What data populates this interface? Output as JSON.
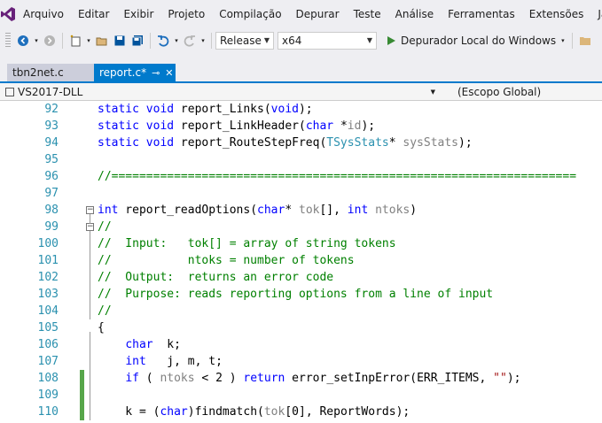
{
  "menu": {
    "items": [
      "Arquivo",
      "Editar",
      "Exibir",
      "Projeto",
      "Compilação",
      "Depurar",
      "Teste",
      "Análise",
      "Ferramentas",
      "Extensões",
      "Ja"
    ]
  },
  "toolbar": {
    "config": "Release",
    "platform": "x64",
    "debugger": "Depurador Local do Windows"
  },
  "tabs": [
    {
      "label": "tbn2net.c",
      "active": false
    },
    {
      "label": "report.c*",
      "active": true
    }
  ],
  "navbar": {
    "project": "VS2017-DLL",
    "scope": "(Escopo Global)"
  },
  "colors": {
    "accent": "#007acc",
    "keyword": "#0000ff",
    "comment": "#008000",
    "type": "#2b91af",
    "string": "#a31515",
    "changed": "#57a64a"
  },
  "code": {
    "lines": [
      {
        "n": "92",
        "tokens": [
          {
            "t": "static void",
            "c": "kw"
          },
          {
            "t": " report_Links("
          },
          {
            "t": "void",
            "c": "kw"
          },
          {
            "t": ");"
          }
        ]
      },
      {
        "n": "93",
        "tokens": [
          {
            "t": "static void",
            "c": "kw"
          },
          {
            "t": " report_LinkHeader("
          },
          {
            "t": "char",
            "c": "kw"
          },
          {
            "t": " *"
          },
          {
            "t": "id",
            "c": "pm"
          },
          {
            "t": ");"
          }
        ]
      },
      {
        "n": "94",
        "tokens": [
          {
            "t": "static void",
            "c": "kw"
          },
          {
            "t": " report_RouteStepFreq("
          },
          {
            "t": "TSysStats",
            "c": "ty"
          },
          {
            "t": "* "
          },
          {
            "t": "sysStats",
            "c": "pm"
          },
          {
            "t": ");"
          }
        ]
      },
      {
        "n": "95",
        "tokens": []
      },
      {
        "n": "96",
        "tokens": [
          {
            "t": "//===================================================================",
            "c": "cm"
          }
        ]
      },
      {
        "n": "97",
        "tokens": []
      },
      {
        "n": "98",
        "fold": true,
        "indent": 0,
        "tokens": [
          {
            "t": "int",
            "c": "kw"
          },
          {
            "t": " report_readOptions("
          },
          {
            "t": "char",
            "c": "kw"
          },
          {
            "t": "* "
          },
          {
            "t": "tok",
            "c": "pm"
          },
          {
            "t": "[], "
          },
          {
            "t": "int",
            "c": "kw"
          },
          {
            "t": " "
          },
          {
            "t": "ntoks",
            "c": "pm"
          },
          {
            "t": ")"
          }
        ]
      },
      {
        "n": "99",
        "fold": true,
        "indent": 0,
        "tokens": [
          {
            "t": "//",
            "c": "cm"
          }
        ]
      },
      {
        "n": "100",
        "tokens": [
          {
            "t": "//  Input:   tok[] = array of string tokens",
            "c": "cm"
          }
        ]
      },
      {
        "n": "101",
        "tokens": [
          {
            "t": "//           ntoks = number of tokens",
            "c": "cm"
          }
        ]
      },
      {
        "n": "102",
        "tokens": [
          {
            "t": "//  Output:  returns an error code",
            "c": "cm"
          }
        ]
      },
      {
        "n": "103",
        "tokens": [
          {
            "t": "//  Purpose: reads reporting options from a line of input",
            "c": "cm"
          }
        ]
      },
      {
        "n": "104",
        "tokens": [
          {
            "t": "//",
            "c": "cm"
          }
        ]
      },
      {
        "n": "105",
        "tokens": [
          {
            "t": "{"
          }
        ]
      },
      {
        "n": "106",
        "tokens": [
          {
            "t": "    "
          },
          {
            "t": "char",
            "c": "kw"
          },
          {
            "t": "  k;"
          }
        ]
      },
      {
        "n": "107",
        "tokens": [
          {
            "t": "    "
          },
          {
            "t": "int",
            "c": "kw"
          },
          {
            "t": "   j, m, t;"
          }
        ]
      },
      {
        "n": "108",
        "changed": true,
        "tokens": [
          {
            "t": "    "
          },
          {
            "t": "if",
            "c": "kw"
          },
          {
            "t": " ( "
          },
          {
            "t": "ntoks",
            "c": "pm"
          },
          {
            "t": " < 2 ) "
          },
          {
            "t": "return",
            "c": "kw"
          },
          {
            "t": " error_setInpError(ERR_ITEMS, "
          },
          {
            "t": "\"\"",
            "c": "st"
          },
          {
            "t": ");"
          }
        ]
      },
      {
        "n": "109",
        "changed": true,
        "tokens": []
      },
      {
        "n": "110",
        "changed": true,
        "tokens": [
          {
            "t": "    k = ("
          },
          {
            "t": "char",
            "c": "kw"
          },
          {
            "t": ")findmatch("
          },
          {
            "t": "tok",
            "c": "pm"
          },
          {
            "t": "[0], ReportWords);"
          }
        ]
      }
    ]
  }
}
